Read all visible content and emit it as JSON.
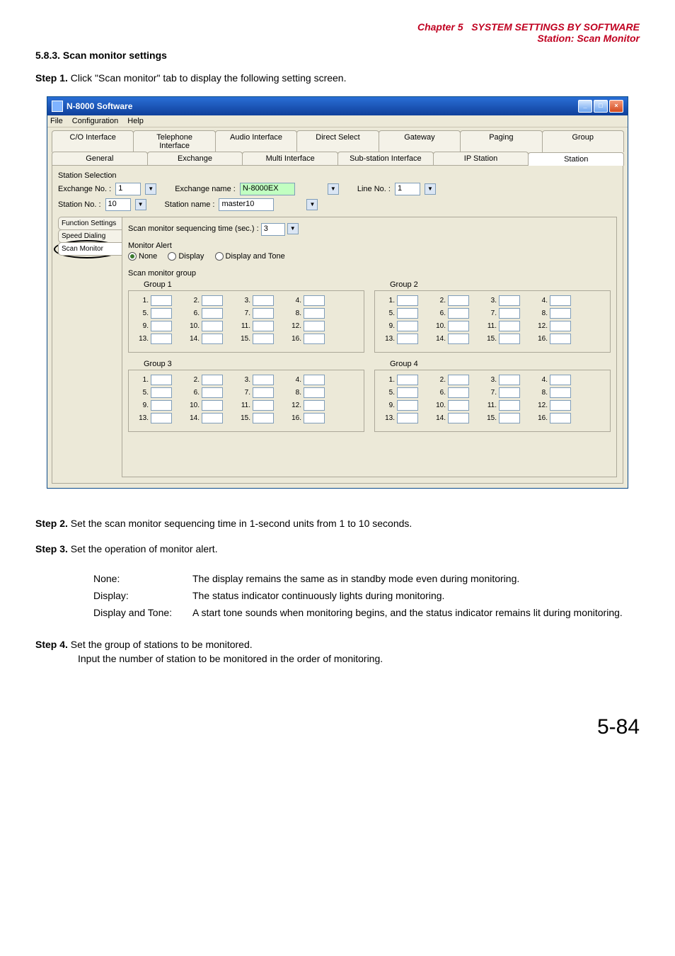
{
  "header": {
    "chapter": "Chapter 5",
    "title1": "SYSTEM SETTINGS BY SOFTWARE",
    "title2": "Station: Scan Monitor"
  },
  "section_heading": "5.8.3. Scan monitor settings",
  "step1": {
    "bold": "Step 1.",
    "text": " Click \"Scan monitor\" tab to display the following setting screen."
  },
  "window": {
    "title": "N-8000 Software",
    "menu": {
      "file": "File",
      "config": "Configuration",
      "help": "Help"
    },
    "tabs_top": {
      "co": "C/O Interface",
      "tel": "Telephone Interface",
      "audio": "Audio Interface",
      "direct": "Direct Select",
      "gateway": "Gateway",
      "paging": "Paging",
      "group": "Group"
    },
    "tabs_second": {
      "general": "General",
      "exchange": "Exchange",
      "multi": "Multi Interface",
      "sub": "Sub-station Interface",
      "ip": "IP Station",
      "station": "Station"
    },
    "station_selection": {
      "heading": "Station Selection",
      "ex_no_label": "Exchange No. :",
      "ex_no_val": "1",
      "ex_name_label": "Exchange name :",
      "ex_name_val": "N-8000EX",
      "line_no_label": "Line No. :",
      "line_no_val": "1",
      "st_no_label": "Station No.     :",
      "st_no_val": "10",
      "st_name_label": "Station name    :",
      "st_name_val": "master10"
    },
    "side_tabs": {
      "func": "Function Settings",
      "speed": "Speed Dialing",
      "scan": "Scan Monitor"
    },
    "scan_panel": {
      "seq_label": "Scan monitor sequencing time (sec.) :",
      "seq_val": "3",
      "mon_alert_heading": "Monitor Alert",
      "none": "None",
      "display": "Display",
      "display_tone": "Display and Tone",
      "group_heading": "Scan monitor group",
      "g1": "Group 1",
      "g2": "Group 2",
      "g3": "Group 3",
      "g4": "Group 4"
    }
  },
  "step2": {
    "bold": "Step 2.",
    "text": " Set the scan monitor sequencing time in 1-second units from 1 to 10 seconds."
  },
  "step3": {
    "bold": "Step 3.",
    "text": " Set the operation of monitor alert.",
    "none_l": "None:",
    "none_r": "The display remains the same as in standby mode even during monitoring.",
    "disp_l": "Display:",
    "disp_r": "The status indicator continuously lights during monitoring.",
    "dt_l": "Display and Tone:",
    "dt_r": "A start tone sounds when monitoring begins, and the status indicator remains lit during monitoring."
  },
  "step4": {
    "bold": "Step 4.",
    "line1": " Set the group of stations to be monitored.",
    "line2": "Input the number of station to be monitored in the order of monitoring."
  },
  "pagenum": "5-84"
}
